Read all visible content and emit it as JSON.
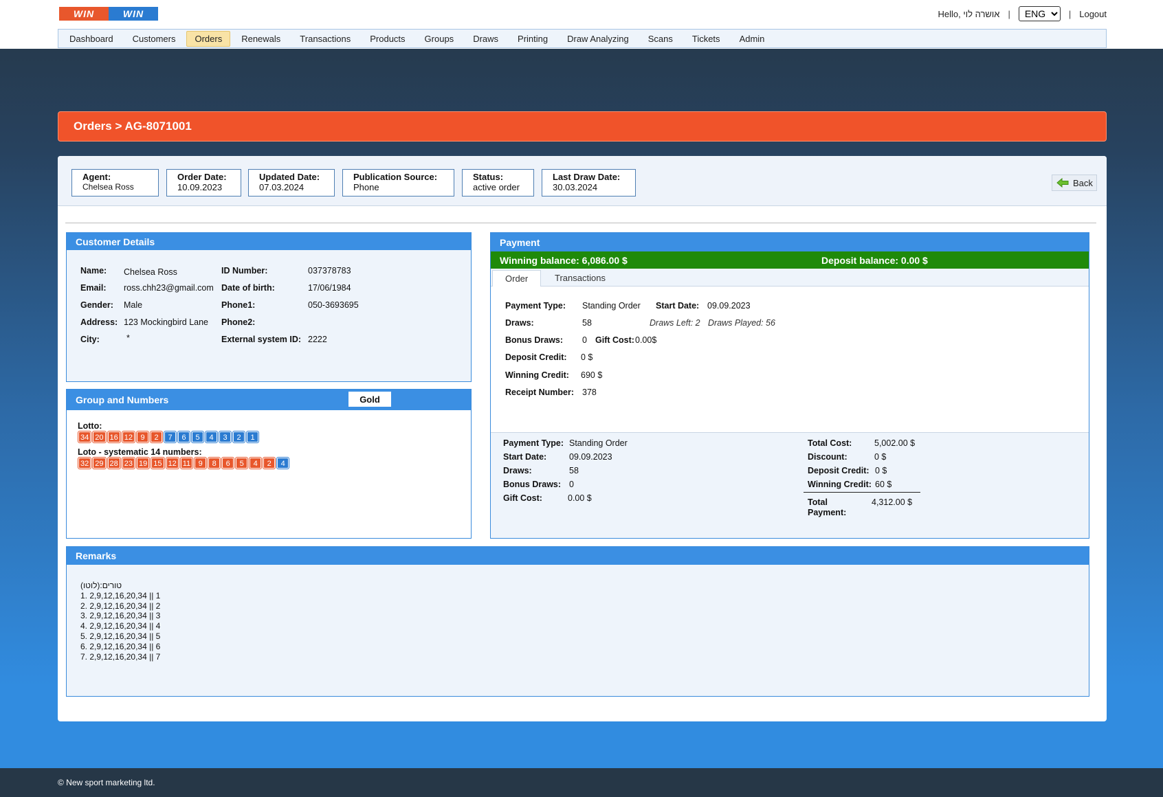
{
  "header": {
    "logo": {
      "part1": "WIN",
      "part2": "WIN"
    },
    "greeting": "Hello, אושרה לוי",
    "separator": "|",
    "language": "ENG",
    "logout": "Logout"
  },
  "nav": [
    "Dashboard",
    "Customers",
    "Orders",
    "Renewals",
    "Transactions",
    "Products",
    "Groups",
    "Draws",
    "Printing",
    "Draw Analyzing",
    "Scans",
    "Tickets",
    "Admin"
  ],
  "nav_active": "Orders",
  "title": "Orders > AG-8071001",
  "info": {
    "agent": {
      "label": "Agent:",
      "value": "Chelsea Ross"
    },
    "order_date": {
      "label": "Order Date:",
      "value": "10.09.2023"
    },
    "updated_date": {
      "label": "Updated Date:",
      "value": "07.03.2024"
    },
    "publication_source": {
      "label": "Publication Source:",
      "value": "Phone"
    },
    "status": {
      "label": "Status:",
      "value": "active order"
    },
    "last_draw_date": {
      "label": "Last Draw Date:",
      "value": "30.03.2024"
    },
    "back": "Back"
  },
  "customer": {
    "heading": "Customer Details",
    "name_label": "Name:",
    "name": "Chelsea Ross",
    "email_label": "Email:",
    "email": "ross.chh23@gmail.com",
    "gender_label": "Gender:",
    "gender": "Male",
    "address_label": "Address:",
    "address": "123 Mockingbird Lane",
    "city_label": "City:",
    "city": "*",
    "id_label": "ID Number:",
    "id": "037378783",
    "dob_label": "Date of birth:",
    "dob": "17/06/1984",
    "phone1_label": "Phone1:",
    "phone1": "050-3693695",
    "phone2_label": "Phone2:",
    "phone2": "",
    "ext_label": "External system ID:",
    "ext": "2222"
  },
  "group": {
    "heading": "Group and Numbers",
    "badge": "Gold",
    "lotto_label": "Lotto:",
    "lotto_red": [
      "34",
      "20",
      "16",
      "12",
      "9",
      "2"
    ],
    "lotto_blue": [
      "7",
      "6",
      "5",
      "4",
      "3",
      "2",
      "1"
    ],
    "loto_sys_label": "Loto - systematic 14 numbers:",
    "loto_sys_red": [
      "32",
      "29",
      "28",
      "23",
      "19",
      "15",
      "12",
      "11",
      "9",
      "8",
      "6",
      "5",
      "4",
      "2"
    ],
    "loto_sys_blue": [
      "4"
    ]
  },
  "payment": {
    "heading": "Payment",
    "winning_balance_label": "Winning balance:",
    "winning_balance": "6,086.00 $",
    "deposit_balance_label": "Deposit balance:",
    "deposit_balance": "0.00 $",
    "tabs": [
      "Order",
      "Transactions"
    ],
    "order": {
      "payment_type_label": "Payment Type:",
      "payment_type": "Standing Order",
      "start_date_label": "Start Date:",
      "start_date": "09.09.2023",
      "draws_label": "Draws:",
      "draws": "58",
      "draws_left": "Draws Left: 2",
      "draws_played": "Draws Played: 56",
      "bonus_label": "Bonus Draws:",
      "bonus": "0",
      "gift_label": "Gift Cost:",
      "gift": "0.00$",
      "deposit_label": "Deposit Credit:",
      "deposit": "0 $",
      "winning_label": "Winning Credit:",
      "winning": "690 $",
      "receipt_label": "Receipt Number:",
      "receipt": "378"
    },
    "summary": {
      "payment_type_label": "Payment Type:",
      "payment_type": "Standing Order",
      "start_date_label": "Start Date:",
      "start_date": "09.09.2023",
      "draws_label": "Draws:",
      "draws": "58",
      "bonus_label": "Bonus Draws:",
      "bonus": "0",
      "gift_label": "Gift Cost:",
      "gift": "0.00 $",
      "total_cost_label": "Total Cost:",
      "total_cost": "5,002.00 $",
      "discount_label": "Discount:",
      "discount": "0 $",
      "deposit_label": "Deposit Credit:",
      "deposit": "0 $",
      "winning_label": "Winning Credit:",
      "winning": "60 $",
      "total_payment_label1": "Total",
      "total_payment_label2": "Payment:",
      "total_payment": "4,312.00 $"
    }
  },
  "remarks": {
    "heading": "Remarks",
    "lines": [
      "טורים:(לוטו)",
      "1. 2,9,12,16,20,34 || 1",
      "2. 2,9,12,16,20,34 || 2",
      "3. 2,9,12,16,20,34 || 3",
      "4. 2,9,12,16,20,34 || 4",
      "5. 2,9,12,16,20,34 || 5",
      "6. 2,9,12,16,20,34 || 6",
      "7. 2,9,12,16,20,34 || 7"
    ]
  },
  "footer": "© New sport marketing ltd."
}
